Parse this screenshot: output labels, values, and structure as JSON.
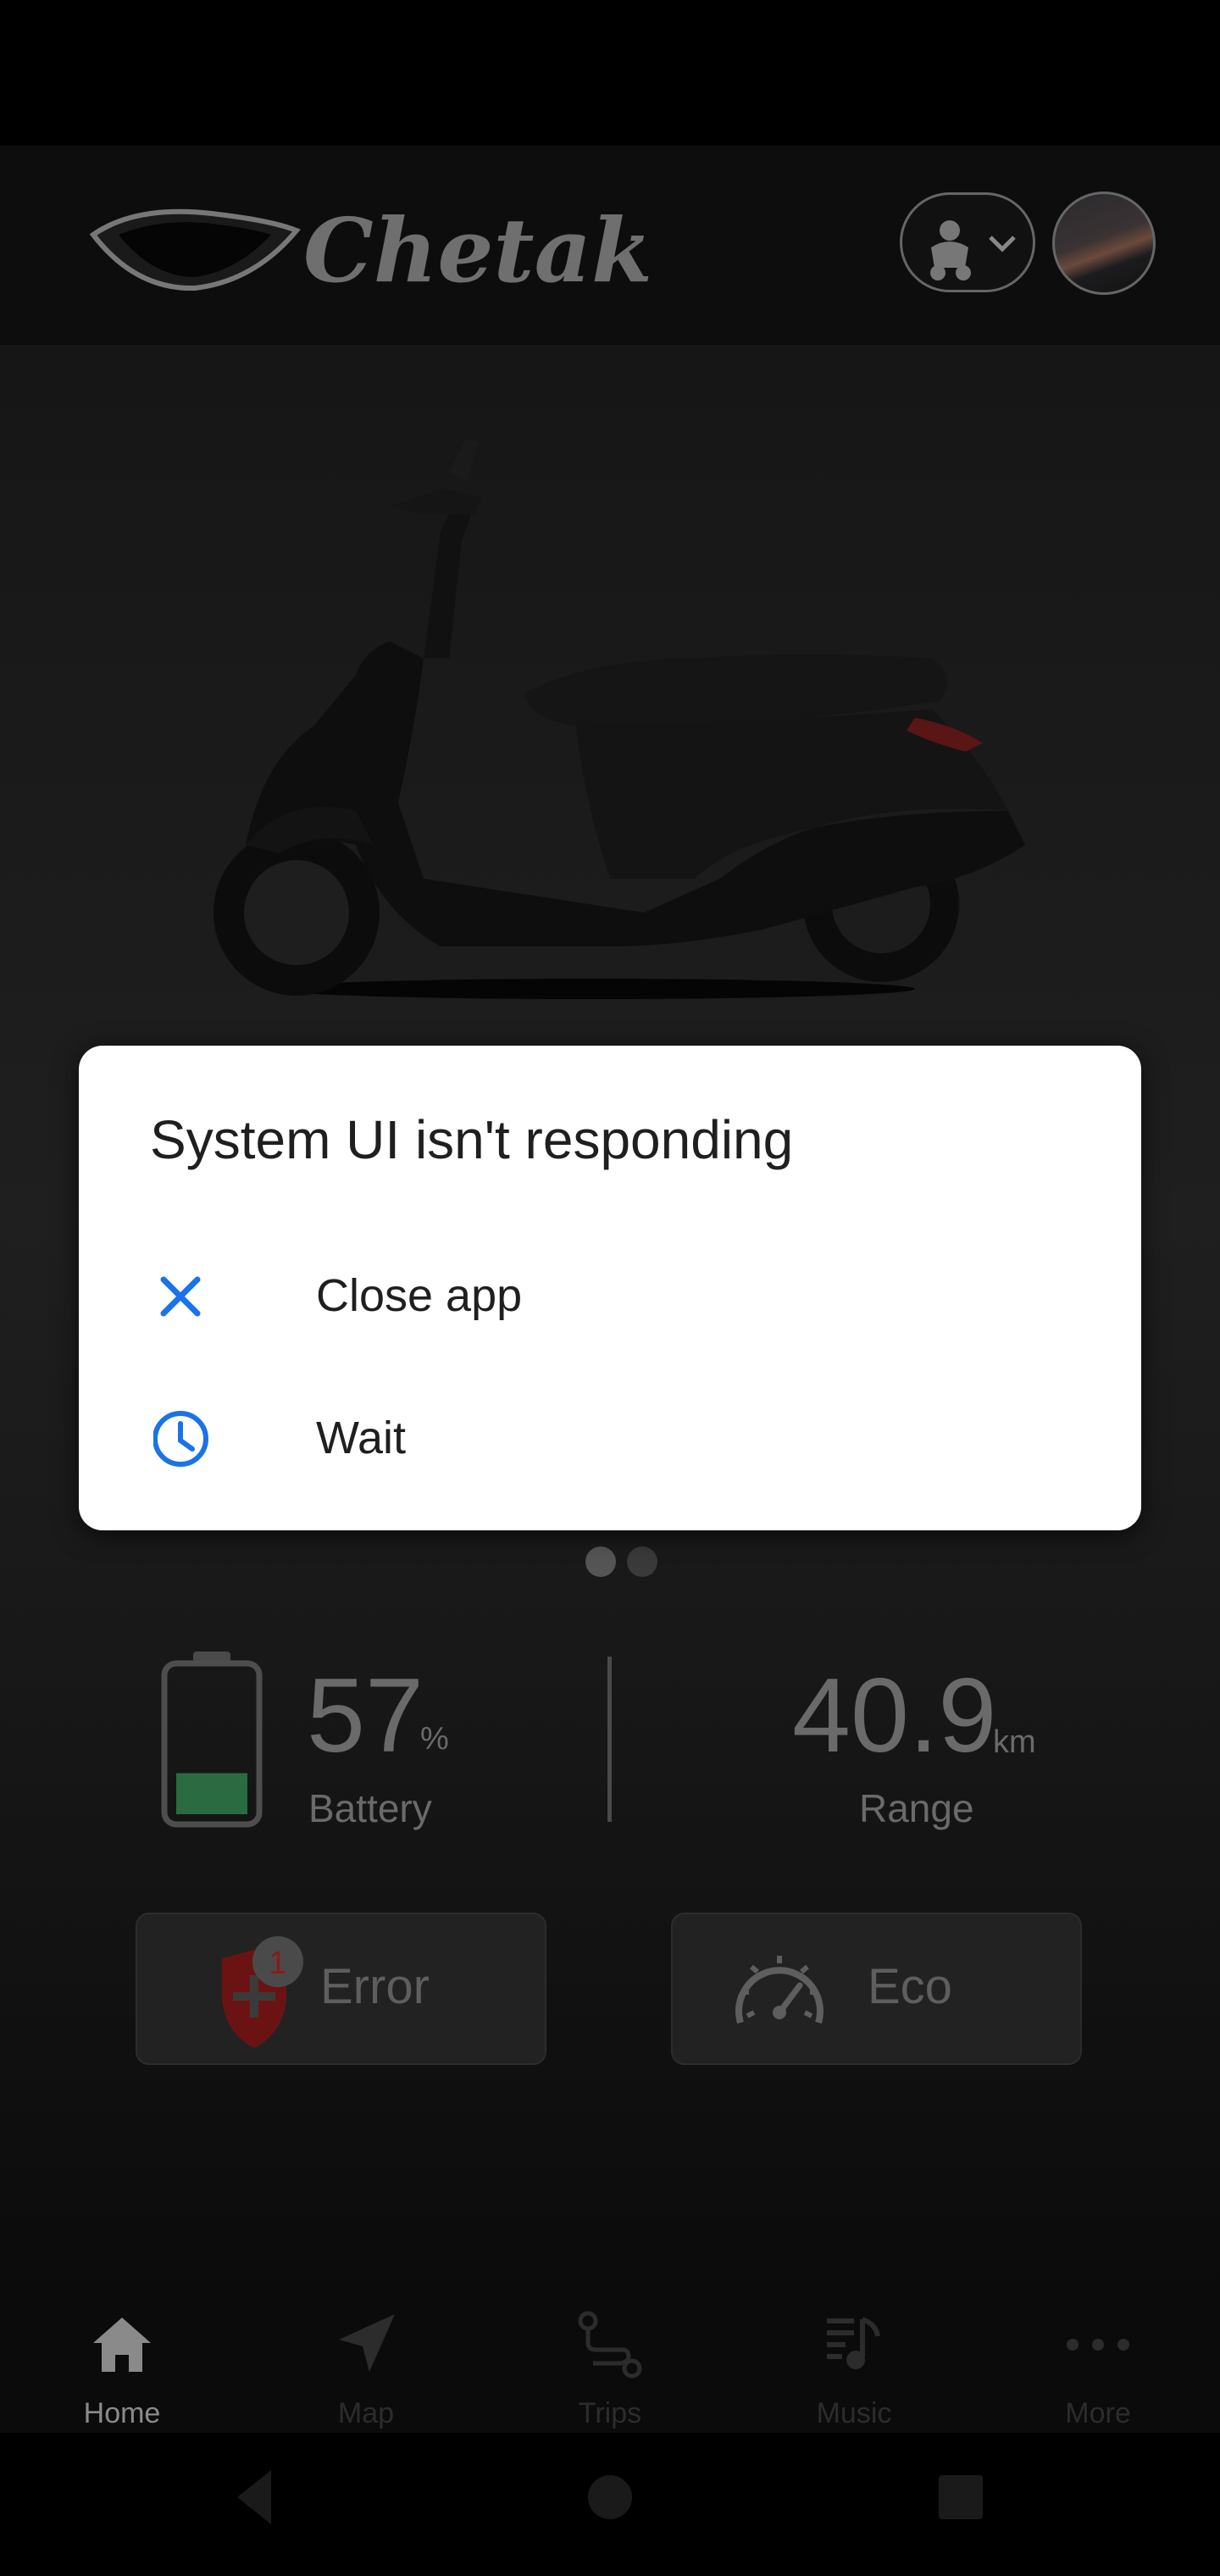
{
  "header": {
    "brand": "Chetak"
  },
  "stats": {
    "battery": {
      "value": "57",
      "unit": "%",
      "label": "Battery",
      "level_percent": 57
    },
    "range": {
      "value": "40.9",
      "unit": "km",
      "label": "Range"
    }
  },
  "cards": {
    "error": {
      "label": "Error",
      "badge": "1"
    },
    "eco": {
      "label": "Eco"
    }
  },
  "nav": {
    "items": [
      {
        "label": "Home",
        "icon": "home-icon",
        "active": true
      },
      {
        "label": "Map",
        "icon": "navigation-arrow-icon",
        "active": false
      },
      {
        "label": "Trips",
        "icon": "route-icon",
        "active": false
      },
      {
        "label": "Music",
        "icon": "music-note-icon",
        "active": false
      },
      {
        "label": "More",
        "icon": "more-dots-icon",
        "active": false
      }
    ]
  },
  "dialog": {
    "title": "System UI isn't responding",
    "options": [
      {
        "label": "Close app",
        "icon": "close-icon"
      },
      {
        "label": "Wait",
        "icon": "clock-icon"
      }
    ]
  },
  "colors": {
    "accent_blue": "#1a73e8",
    "battery_fill": "#2a6b42",
    "error_red": "#8b1a1a"
  }
}
